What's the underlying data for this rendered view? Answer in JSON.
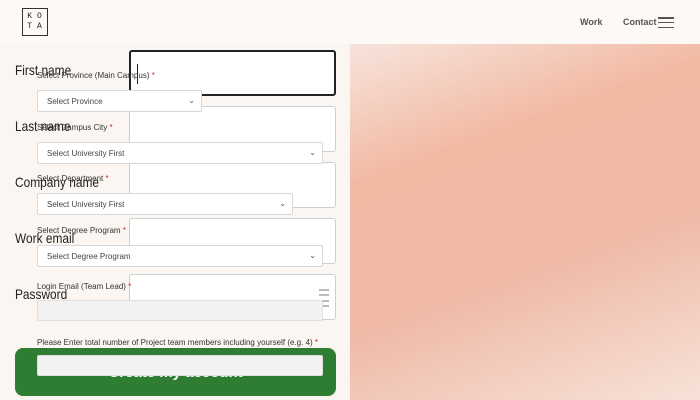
{
  "header": {
    "logo_top": "KO",
    "logo_bottom": "TA",
    "nav_work": "Work",
    "nav_contact": "Contact"
  },
  "signup": {
    "first_name_label": "First name",
    "last_name_label": "Last name",
    "company_name_label": "Company name",
    "work_email_label": "Work email",
    "password_label": "Password",
    "create_button": "Create my account"
  },
  "registration": {
    "province_label": "Select Province (Main Campus)",
    "province_value": "Select Province",
    "campus_city_label": "Select Campus City",
    "campus_city_value": "Select University First",
    "department_label": "Select Department",
    "department_value": "Select University First",
    "degree_label": "Select Degree Program",
    "degree_value": "Select Degree Program",
    "login_email_label": "Login Email (Team Lead)",
    "team_members_label": "Please Enter total number of Project team members including yourself (e.g. 4)",
    "required_marker": "*"
  },
  "colors": {
    "create_button": "#2e7d32",
    "required": "#c62828"
  }
}
